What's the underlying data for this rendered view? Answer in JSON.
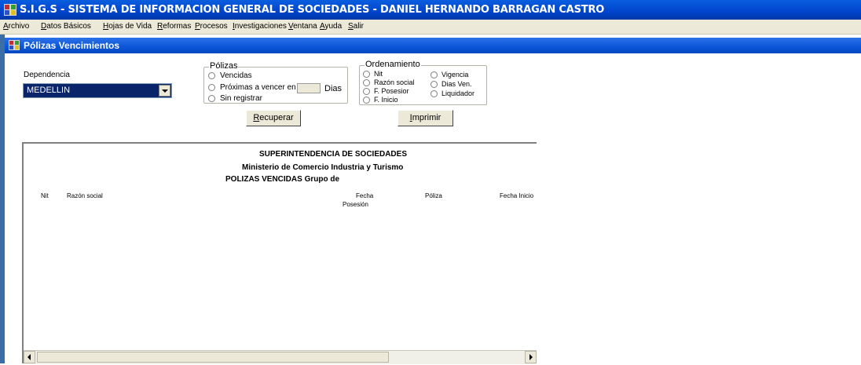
{
  "app": {
    "title": "S.I.G.S   - SISTEMA DE INFORMACION GENERAL DE SOCIEDADES - DANIEL HERNANDO BARRAGAN CASTRO"
  },
  "menu": [
    {
      "first": "A",
      "rest": "rchivo"
    },
    {
      "first": "D",
      "rest": "atos Básicos"
    },
    {
      "first": "H",
      "rest": "ojas de Vida"
    },
    {
      "first": "R",
      "rest": "eformas"
    },
    {
      "first": "P",
      "rest": "rocesos"
    },
    {
      "first": "I",
      "rest": "nvestigaciones"
    },
    {
      "first": "V",
      "rest": "entana"
    },
    {
      "first": "A",
      "rest": "yuda"
    },
    {
      "first": "S",
      "rest": "alir"
    }
  ],
  "window": {
    "title": "Pólizas Vencimientos"
  },
  "dependencia": {
    "label": "Dependencia",
    "value": "MEDELLIN"
  },
  "polizas": {
    "legend": "Pólizas",
    "options": [
      "Vencidas",
      "Próximas a vencer en",
      "Sin registrar"
    ],
    "days_suffix": "Dias",
    "days_value": ""
  },
  "ordenamiento": {
    "legend": "Ordenamiento",
    "options_left": [
      "Nit",
      "Razón social",
      "F. Posesior",
      "F. Inicio"
    ],
    "options_right": [
      "Vigencia",
      "Dias Ven.",
      "Liquidador"
    ]
  },
  "buttons": {
    "recuperar": {
      "first": "R",
      "rest": "ecuperar"
    },
    "imprimir": {
      "first": "I",
      "rest": "mprimir"
    }
  },
  "report": {
    "line1": "SUPERINTENDENCIA DE SOCIEDADES",
    "line2": "Ministerio de Comercio Industria y Turismo",
    "line3": "POLIZAS VENCIDAS   Grupo de",
    "columns": {
      "nit": "Nit",
      "razon": "Razón social",
      "fecha1": "Fecha",
      "fecha2": "Posesión",
      "poliza": "Póliza",
      "inicio": "Fecha Inicio"
    }
  }
}
